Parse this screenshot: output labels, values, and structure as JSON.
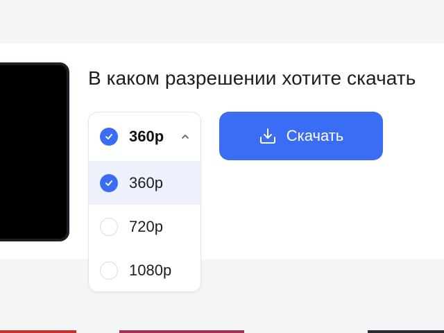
{
  "question": "В каком разрешении хотите скачать",
  "resolution_select": {
    "selected": "360p",
    "options": [
      {
        "label": "360p",
        "selected": true
      },
      {
        "label": "720p",
        "selected": false
      },
      {
        "label": "1080p",
        "selected": false
      }
    ]
  },
  "download_button": {
    "label": "Скачать",
    "icon": "download-icon"
  },
  "colors": {
    "accent": "#3a6cf4",
    "selected_row": "#edf1fb",
    "text": "#1a1d24"
  }
}
